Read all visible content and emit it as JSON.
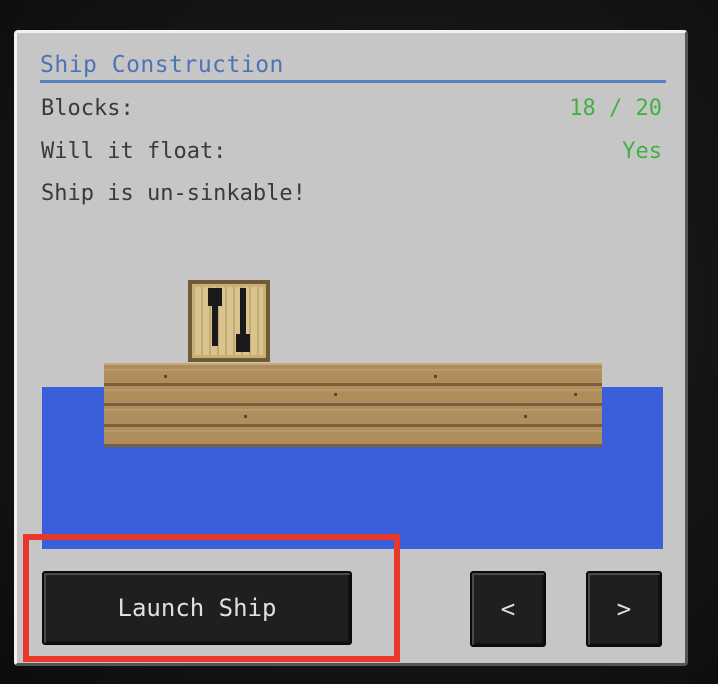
{
  "panel": {
    "title": "Ship Construction",
    "rows": [
      {
        "label": "Blocks:",
        "value": "18 / 20"
      },
      {
        "label": "Will it float:",
        "value": "Yes"
      }
    ],
    "status": "Ship is un-sinkable!"
  },
  "buttons": {
    "launch_label": "Launch Ship",
    "prev_label": "<",
    "next_label": ">"
  },
  "colors": {
    "title": "#4d74b8",
    "value_ok": "#43b043",
    "water": "#3b5fdb",
    "highlight": "#e8382c"
  }
}
